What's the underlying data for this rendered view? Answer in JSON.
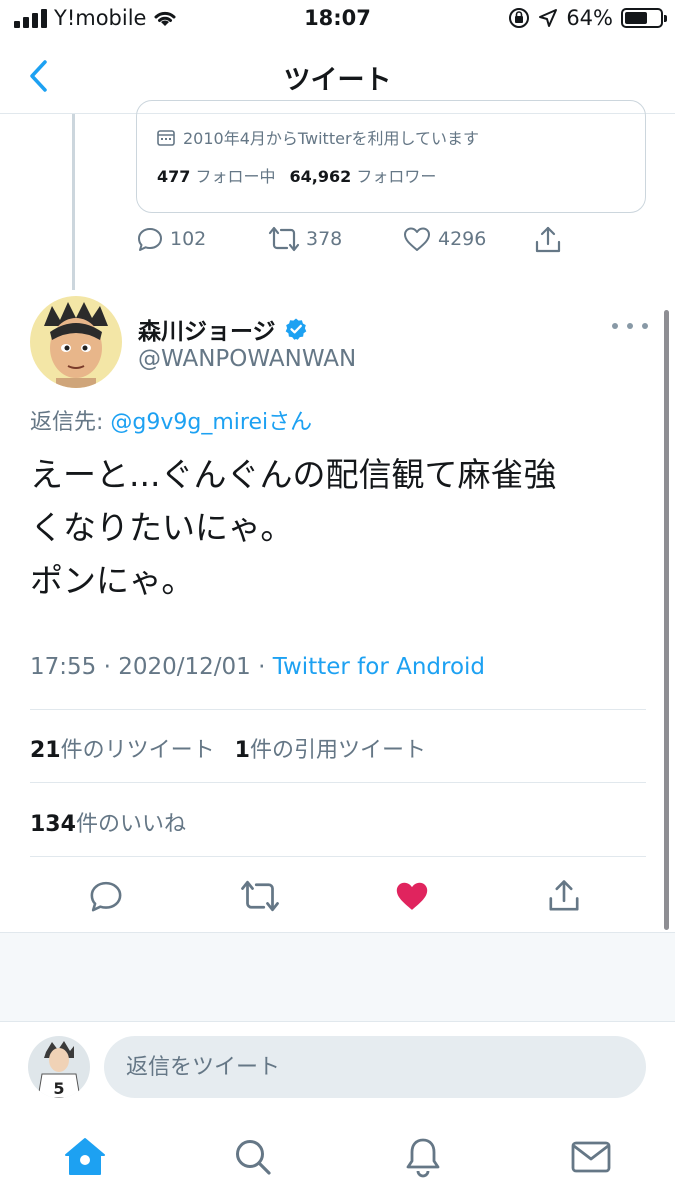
{
  "status_bar": {
    "carrier": "Y!mobile",
    "time": "18:07",
    "battery_percent": "64%",
    "battery_level": 0.64
  },
  "header": {
    "title": "ツイート"
  },
  "previous_tweet": {
    "profile_card": {
      "joined": "2010年4月からTwitterを利用しています",
      "following_count": "477",
      "following_label": "フォロー中",
      "followers_count": "64,962",
      "followers_label": "フォロワー"
    },
    "actions": {
      "replies": "102",
      "retweets": "378",
      "likes": "4296"
    }
  },
  "tweet": {
    "author_name": "森川ジョージ",
    "verified": true,
    "author_handle": "@WANPOWANWAN",
    "reply_to_label": "返信先: ",
    "reply_to_user": "@g9v9g_mireiさん",
    "text": "えーと...ぐんぐんの配信観て麻雀強\nくなりたいにゃ。\nポンにゃ。",
    "time": "17:55",
    "date": "2020/12/01",
    "source": "Twitter for Android",
    "retweet_count": "21",
    "retweet_label": "件のリツイート",
    "quote_count": "1",
    "quote_label": "件の引用ツイート",
    "like_count": "134",
    "like_label": "件のいいね",
    "liked": true
  },
  "reply_box": {
    "placeholder": "返信をツイート"
  },
  "tabs": [
    {
      "icon": "home-icon",
      "active": true
    },
    {
      "icon": "search-icon",
      "active": false
    },
    {
      "icon": "bell-icon",
      "active": false
    },
    {
      "icon": "mail-icon",
      "active": false
    }
  ],
  "colors": {
    "accent": "#1da1f2",
    "like": "#e0245e",
    "secondary_text": "#657786",
    "divider": "#e1e8ed"
  }
}
